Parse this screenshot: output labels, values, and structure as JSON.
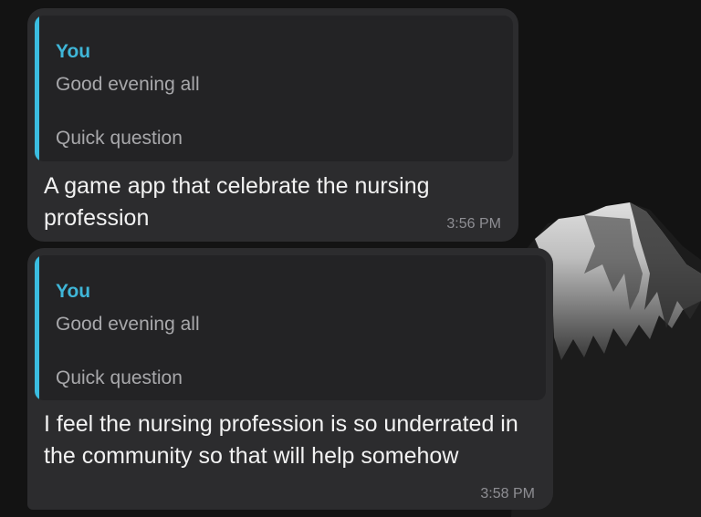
{
  "messages": [
    {
      "reply_to": {
        "author": "You",
        "lines": [
          "Good evening all",
          "Quick question"
        ]
      },
      "text": "A game app that celebrate the nursing profession",
      "time": "3:56 PM"
    },
    {
      "reply_to": {
        "author": "You",
        "lines": [
          "Good evening all",
          "Quick question"
        ]
      },
      "text": "I feel the nursing profession is so underrated in the community so that will help somehow",
      "time": "3:58 PM"
    }
  ],
  "colors": {
    "bubble": "#2c2c2e",
    "quote_background": "#232325",
    "quote_accent": "#3bbde0",
    "author": "#3fb6d8"
  },
  "background": "dark wallpaper with snow-capped mountain peak"
}
